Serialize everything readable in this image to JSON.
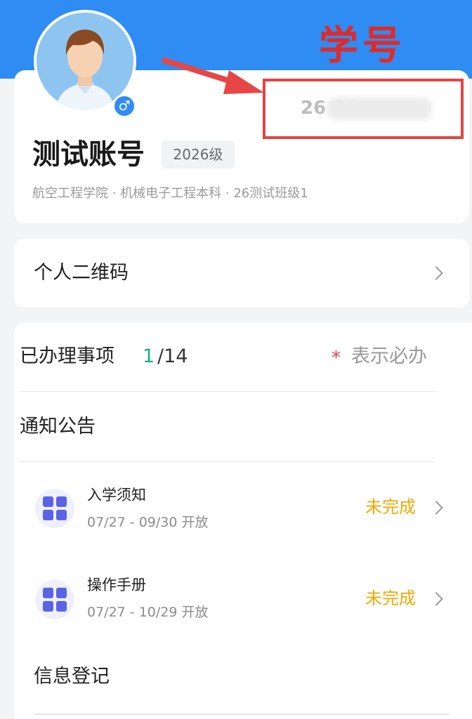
{
  "annotation": {
    "label": "学号"
  },
  "profile": {
    "student_id": "26          01",
    "name": "测试账号",
    "grade": "2026级",
    "affiliation": "航空工程学院 · 机械电子工程本科 · 26测试班级1",
    "gender_symbol": "♂"
  },
  "qr": {
    "label": "个人二维码"
  },
  "tasks_header": {
    "title": "已办理事项",
    "done": "1",
    "total": "/14",
    "star": "*",
    "required_hint": "表示必办"
  },
  "notices": {
    "title": "通知公告",
    "items": [
      {
        "title": "入学须知",
        "period": "07/27 - 09/30 开放",
        "status": "未完成"
      },
      {
        "title": "操作手册",
        "period": "07/27 - 10/29 开放",
        "status": "未完成"
      }
    ]
  },
  "info_registration": {
    "title": "信息登记"
  },
  "colors": {
    "brand": "#2f8cf2",
    "annotation": "#e02a2a",
    "done": "#18b27a",
    "pending": "#f2a800",
    "task_icon": "#5a63e6"
  }
}
